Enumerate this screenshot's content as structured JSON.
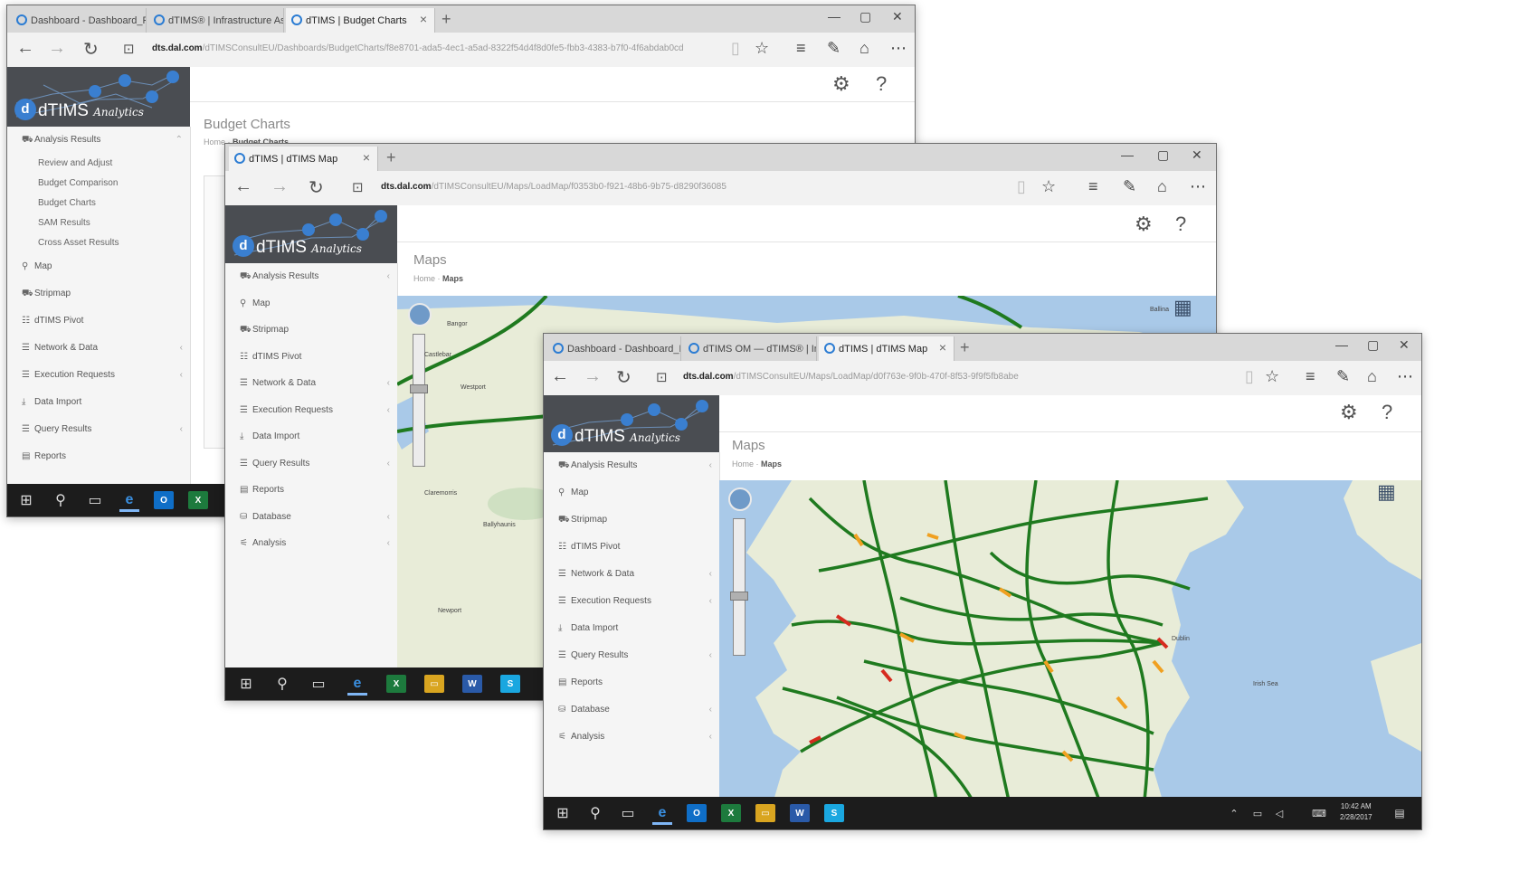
{
  "w1": {
    "tabs": [
      "Dashboard - Dashboard_Fs",
      "dTIMS® | Infrastructure Ass",
      "dTIMS | Budget Charts"
    ],
    "url_host": "dts.dal.com",
    "url_path": "/dTIMSConsultEU/Dashboards/BudgetCharts/f8e8701-ada5-4ec1-a5ad-8322f54d4f8d0fe5-fbb3-4383-b7f0-4f6abdab0cd",
    "logo_main": "dTIMS",
    "logo_sub": "Analytics",
    "page_title": "Budget Charts",
    "crumb_home": "Home",
    "crumb_sep": "·",
    "crumb_current": "Budget Charts",
    "sidebar": [
      {
        "icon": "⛟",
        "label": "Analysis Results",
        "chev": "⌃"
      },
      {
        "sub": true,
        "label": "Review and Adjust"
      },
      {
        "sub": true,
        "label": "Budget Comparison"
      },
      {
        "sub": true,
        "label": "Budget Charts"
      },
      {
        "sub": true,
        "label": "SAM Results"
      },
      {
        "sub": true,
        "label": "Cross Asset Results"
      },
      {
        "icon": "⚲",
        "label": "Map"
      },
      {
        "icon": "⛟",
        "label": "Stripmap"
      },
      {
        "icon": "☷",
        "label": "dTIMS Pivot"
      },
      {
        "icon": "☰",
        "label": "Network & Data",
        "chev": "‹"
      },
      {
        "icon": "☰",
        "label": "Execution Requests",
        "chev": "‹"
      },
      {
        "icon": "⤓",
        "label": "Data Import"
      },
      {
        "icon": "☰",
        "label": "Query Results",
        "chev": "‹"
      },
      {
        "icon": "▤",
        "label": "Reports"
      }
    ]
  },
  "w2": {
    "tabs": [
      "dTIMS | dTIMS Map"
    ],
    "url_host": "dts.dal.com",
    "url_path": "/dTIMSConsultEU/Maps/LoadMap/f0353b0-f921-48b6-9b75-d8290f36085",
    "logo_main": "dTIMS",
    "logo_sub": "Analytics",
    "page_title": "Maps",
    "crumb_home": "Home",
    "crumb_sep": "·",
    "crumb_current": "Maps",
    "sidebar": [
      {
        "icon": "⛟",
        "label": "Analysis Results",
        "chev": "‹"
      },
      {
        "icon": "⚲",
        "label": "Map"
      },
      {
        "icon": "⛟",
        "label": "Stripmap"
      },
      {
        "icon": "☷",
        "label": "dTIMS Pivot"
      },
      {
        "icon": "☰",
        "label": "Network & Data",
        "chev": "‹"
      },
      {
        "icon": "☰",
        "label": "Execution Requests",
        "chev": "‹"
      },
      {
        "icon": "⤓",
        "label": "Data Import"
      },
      {
        "icon": "☰",
        "label": "Query Results",
        "chev": "‹"
      },
      {
        "icon": "▤",
        "label": "Reports"
      },
      {
        "icon": "⛁",
        "label": "Database",
        "chev": "‹"
      },
      {
        "icon": "⚟",
        "label": "Analysis",
        "chev": "‹"
      }
    ],
    "places": [
      "Bangor",
      "Ballina",
      "Castlebar",
      "Westport",
      "Ballyhaunis",
      "Claremorris",
      "Newport"
    ]
  },
  "w3": {
    "tabs": [
      "Dashboard - Dashboard_Fs",
      "dTIMS OM — dTIMS® | Infr",
      "dTIMS | dTIMS Map"
    ],
    "url_host": "dts.dal.com",
    "url_path": "/dTIMSConsultEU/Maps/LoadMap/d0f763e-9f0b-470f-8f53-9f9f5fb8abe",
    "logo_main": "dTIMS",
    "logo_sub": "Analytics",
    "page_title": "Maps",
    "crumb_home": "Home",
    "crumb_sep": "·",
    "crumb_current": "Maps",
    "sidebar": [
      {
        "icon": "⛟",
        "label": "Analysis Results",
        "chev": "‹"
      },
      {
        "icon": "⚲",
        "label": "Map"
      },
      {
        "icon": "⛟",
        "label": "Stripmap"
      },
      {
        "icon": "☷",
        "label": "dTIMS Pivot"
      },
      {
        "icon": "☰",
        "label": "Network & Data",
        "chev": "‹"
      },
      {
        "icon": "☰",
        "label": "Execution Requests",
        "chev": "‹"
      },
      {
        "icon": "⤓",
        "label": "Data Import"
      },
      {
        "icon": "☰",
        "label": "Query Results",
        "chev": "‹"
      },
      {
        "icon": "▤",
        "label": "Reports"
      },
      {
        "icon": "⛁",
        "label": "Database",
        "chev": "‹"
      },
      {
        "icon": "⚟",
        "label": "Analysis",
        "chev": "‹"
      }
    ],
    "places": [
      "Irish Sea",
      "Dublin"
    ],
    "clock_time": "10:42 AM",
    "clock_date": "2/28/2017"
  },
  "colors": {
    "road_good": "#1f7a1f",
    "road_fair": "#f0a020",
    "road_poor": "#d62b1f",
    "sea": "#a9c9e8",
    "land": "#e8ecd8",
    "brand_blue": "#3a7fd0",
    "logo_bg": "#4a4d52"
  }
}
